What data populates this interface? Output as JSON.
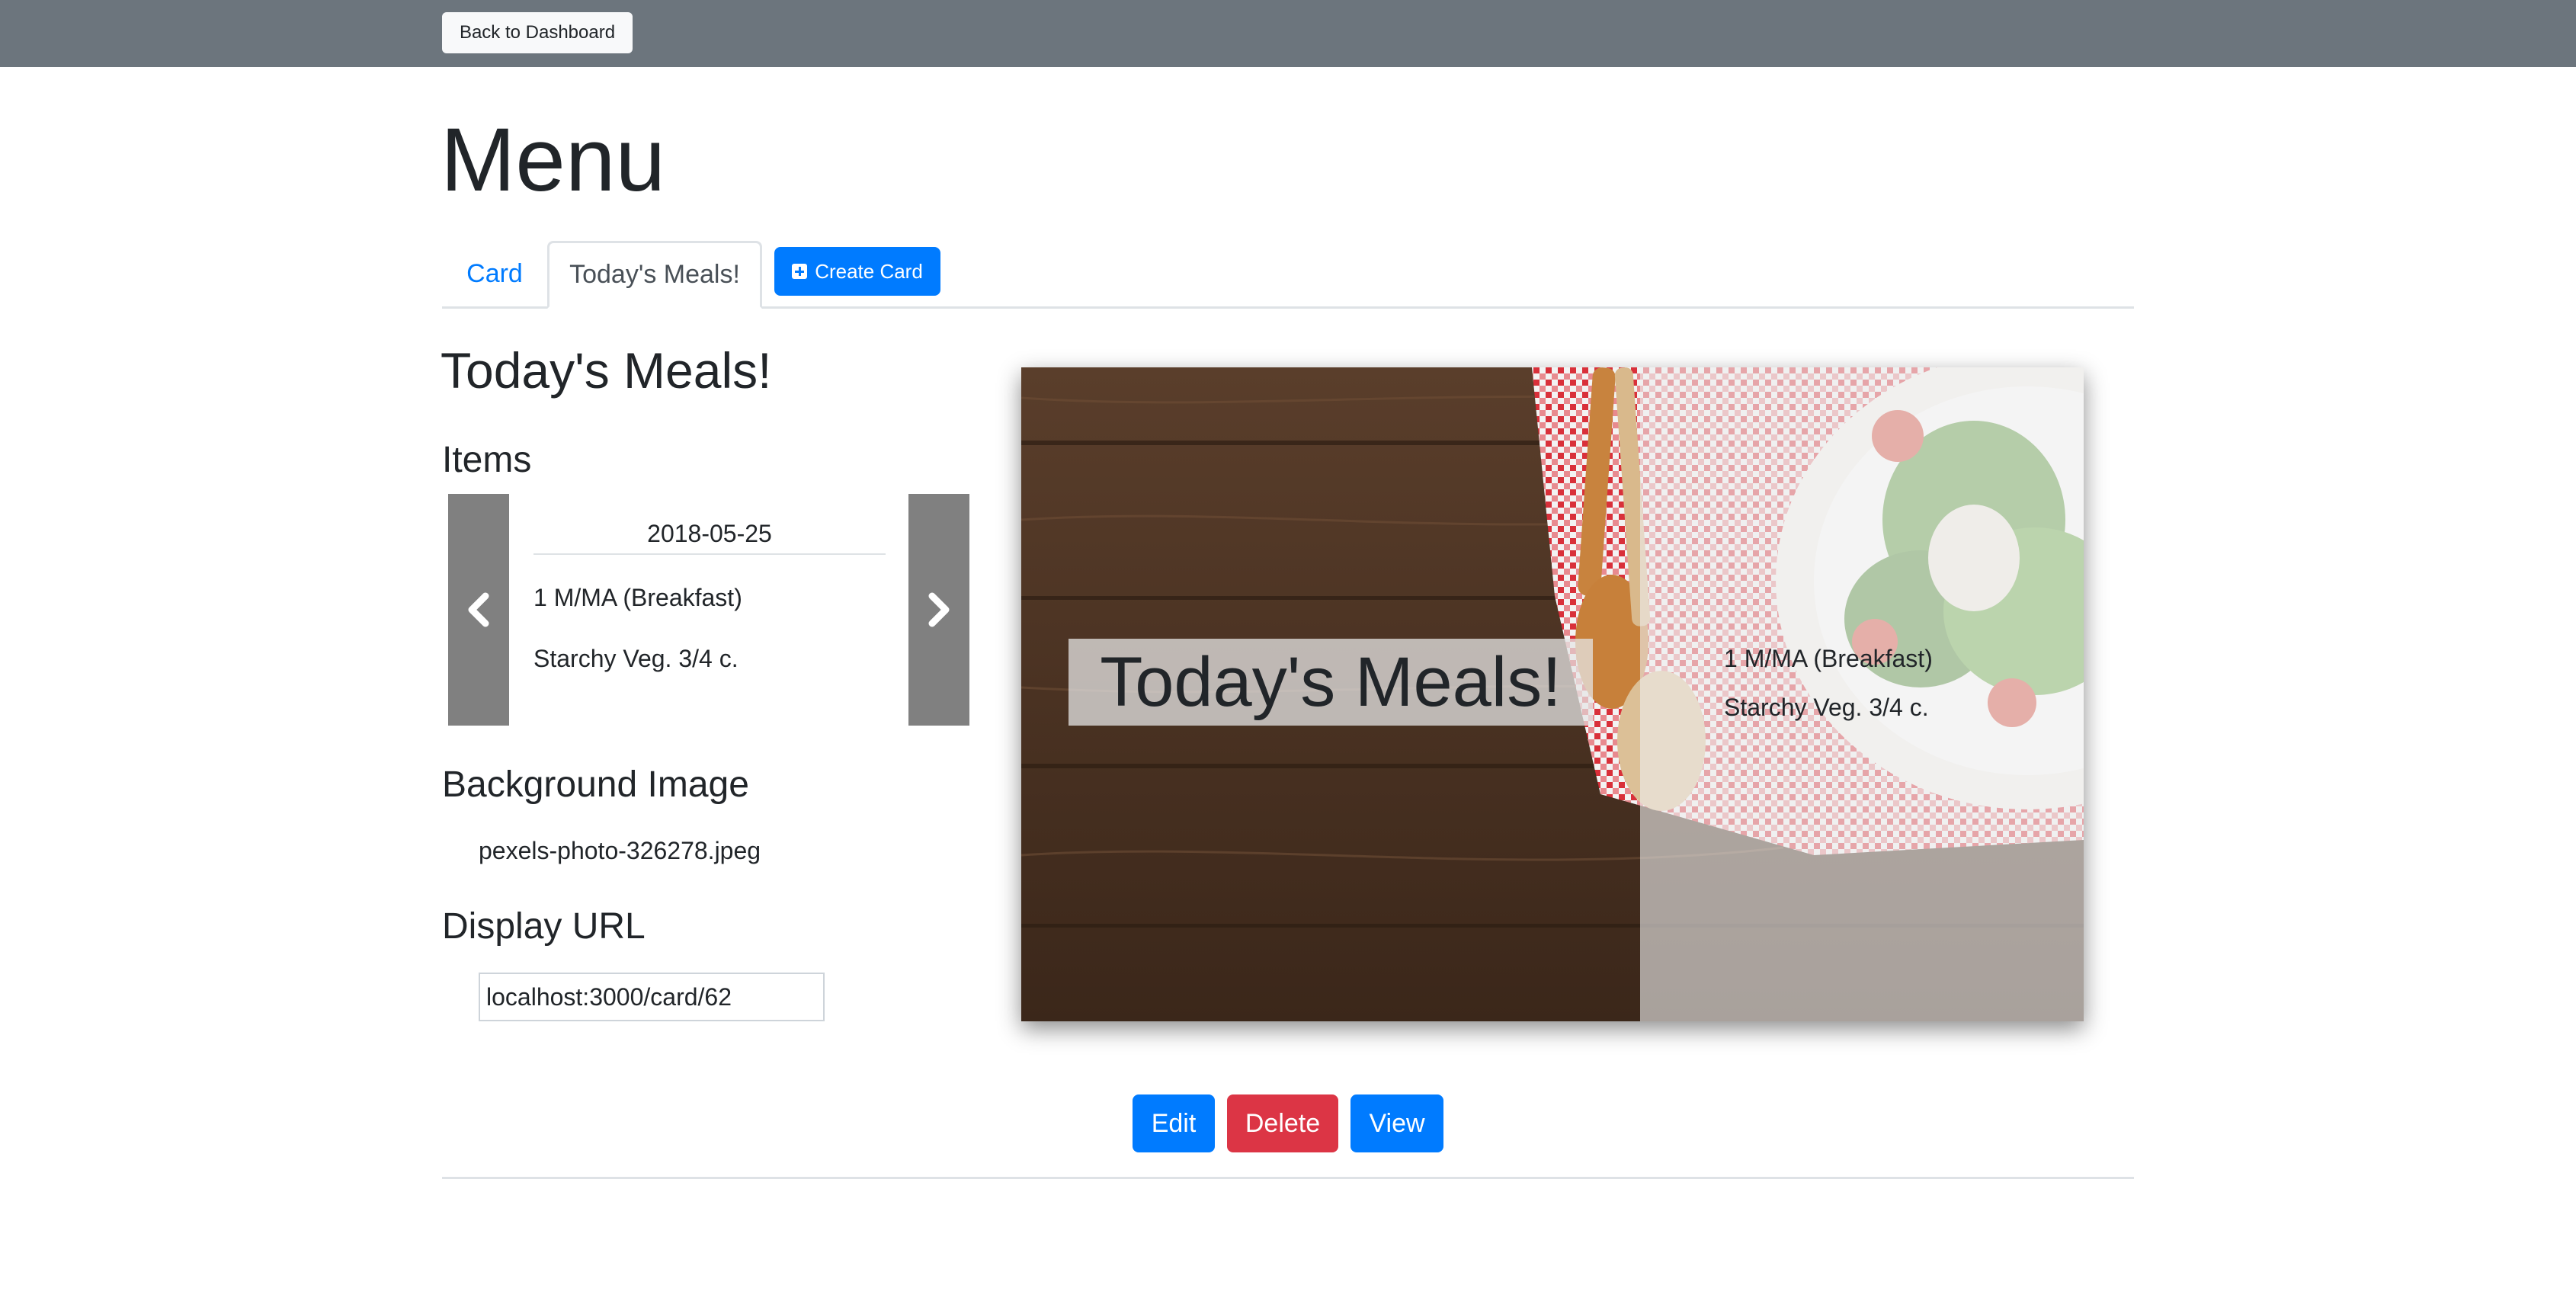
{
  "header": {
    "back_label": "Back to Dashboard"
  },
  "page": {
    "title": "Menu"
  },
  "tabs": [
    {
      "label": "Card"
    },
    {
      "label": "Today's Meals!"
    }
  ],
  "create_button": {
    "label": "Create Card",
    "icon": "plus-square-icon"
  },
  "card": {
    "title": "Today's Meals!",
    "items_heading": "Items",
    "slide": {
      "date": "2018-05-25",
      "items": [
        "1 M/MA (Breakfast)",
        "Starchy Veg. 3/4 c."
      ]
    },
    "background_heading": "Background Image",
    "background_file": "pexels-photo-326278.jpeg",
    "display_url_heading": "Display URL",
    "display_url": "localhost:3000/card/62"
  },
  "preview": {
    "title": "Today's Meals!",
    "items": [
      "1 M/MA (Breakfast)",
      "Starchy Veg. 3/4 c."
    ]
  },
  "actions": {
    "edit": "Edit",
    "delete": "Delete",
    "view": "View"
  },
  "colors": {
    "topbar": "#6c757d",
    "primary": "#007bff",
    "danger": "#dc3545",
    "carousel_control": "#808080"
  }
}
